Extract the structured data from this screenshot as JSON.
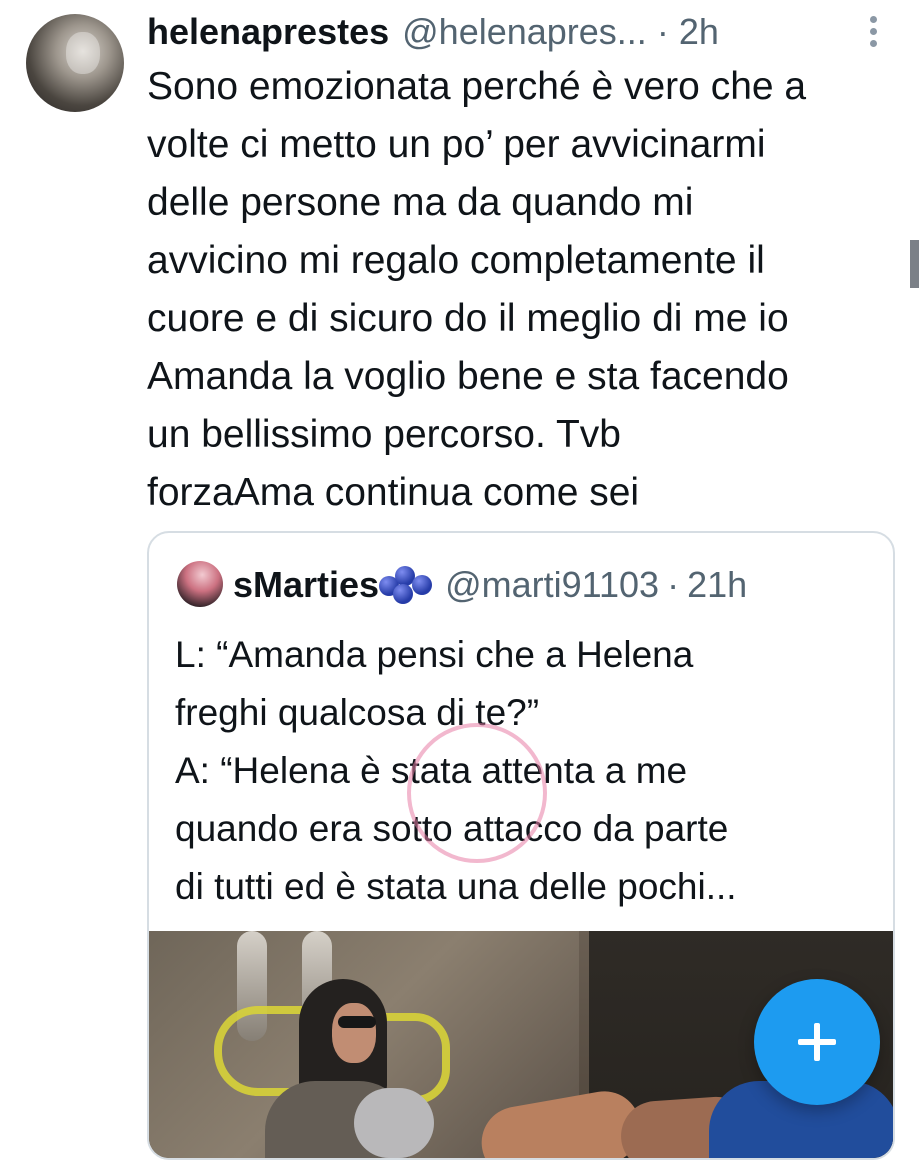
{
  "tweet": {
    "display_name": "helenaprestes",
    "handle": "@helenapres...",
    "separator": "·",
    "time": "2h",
    "text": "Sono emozionata perché è vero che a\nvolte ci metto un po’ per avvicinarmi\ndelle persone ma da quando mi\navvicino mi regalo completamente il\ncuore e di sicuro do il meglio di me io\nAmanda la voglio bene e sta facendo\nun bellissimo percorso. Tvb\nforzaAma continua come sei"
  },
  "quoted_tweet": {
    "display_name": "sMarties",
    "handle": "@marti91103",
    "separator": "·",
    "time": "21h",
    "text": "L: “Amanda pensi che a Helena\nfreghi qualcosa di te?”\nA: “Helena è stata attenta a me\nquando era sotto attacco da parte\ndi tutti ed è stata una delle pochi..."
  },
  "icons": {
    "more": "more-vertical-icon",
    "compose": "plus-icon",
    "emoji": "blueberries-icon"
  },
  "colors": {
    "accent": "#1d9bf0",
    "text": "#0f1419",
    "muted": "#536471",
    "border": "#d6dde3"
  }
}
